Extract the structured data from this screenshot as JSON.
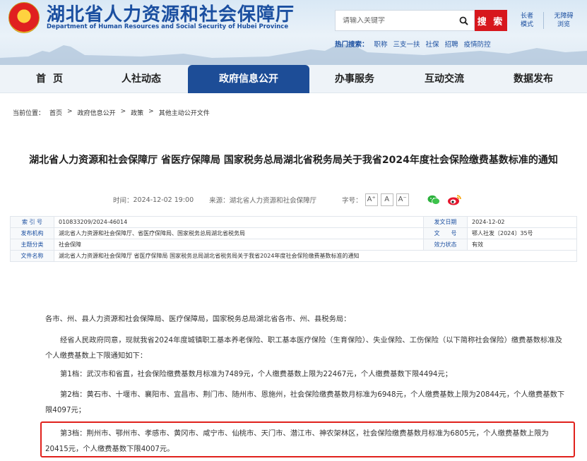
{
  "header": {
    "title": "湖北省人力资源和社会保障厅",
    "subtitle": "Department of Human Resources and Social Security of Hubei Province",
    "search_placeholder": "请输入关键字",
    "search_button": "搜 索",
    "elder_mode": [
      "长者",
      "模式"
    ],
    "accessible": [
      "无障碍",
      "浏览"
    ],
    "hot_label": "热门搜索：",
    "hot_items": [
      "职称",
      "三支一扶",
      "社保",
      "招聘",
      "疫情防控"
    ]
  },
  "nav": {
    "items": [
      "首页",
      "人社动态",
      "政府信息公开",
      "办事服务",
      "互动交流",
      "数据发布"
    ],
    "active": "政府信息公开"
  },
  "breadcrumb": {
    "label": "当前位置：",
    "items": [
      "首页",
      "政府信息公开",
      "政策",
      "其他主动公开文件"
    ],
    "separator": ">"
  },
  "article": {
    "title": "湖北省人力资源和社会保障厅 省医疗保障局 国家税务总局湖北省税务局关于我省2024年度社会保险缴费基数标准的通知",
    "time_label": "时间：",
    "time": "2024-12-02 19:00",
    "source_label": "来源：",
    "source": "湖北省人力资源和社会保障厅",
    "font_label": "字号：",
    "font_sizes": [
      "A⁺",
      "A",
      "A⁻"
    ]
  },
  "info_table": {
    "index_label": "索 引 号",
    "index": "010833209/2024-46014",
    "date_label": "发文日期",
    "date": "2024-12-02",
    "issuer_label": "发布机构",
    "issuer": "湖北省人力资源和社会保障厅、省医疗保障局、国家税务总局湖北省税务局",
    "docno_label": "文　　号",
    "docno": "鄂人社发〔2024〕35号",
    "topic_label": "主题分类",
    "topic": "社会保障",
    "validity_label": "效力状态",
    "validity": "有效",
    "filename_label": "文件名称",
    "filename": "湖北省人力资源和社会保障厅 省医疗保障局 国家税务总局湖北省税务局关于我省2024年度社会保险缴费基数标准的通知"
  },
  "body": {
    "greeting": "各市、州、县人力资源和社会保障局、医疗保障局，国家税务总局湖北省各市、州、县税务局：",
    "p1": "经省人民政府同意，现就我省2024年度城镇职工基本养老保险、职工基本医疗保险（生育保险）、失业保险、工伤保险（以下简称社会保险）缴费基数标准及个人缴费基数上下限通知如下：",
    "p2": "第1档：武汉市和省直，社会保险缴费基数月标准为7489元，个人缴费基数上限为22467元，个人缴费基数下限4494元；",
    "p3": "第2档：黄石市、十堰市、襄阳市、宜昌市、荆门市、随州市、恩施州，社会保险缴费基数月标准为6948元，个人缴费基数上限为20844元，个人缴费基数下限4097元；",
    "p4": "第3档：荆州市、鄂州市、孝感市、黄冈市、咸宁市、仙桃市、天门市、潜江市、神农架林区，社会保险缴费基数月标准为6805元，个人缴费基数上限为20415元，个人缴费基数下限4007元。"
  },
  "colors": {
    "brand_blue": "#1b4fa0",
    "nav_active": "#1d4d97",
    "search_red": "#d7171d",
    "highlight_red": "#e0211c"
  }
}
